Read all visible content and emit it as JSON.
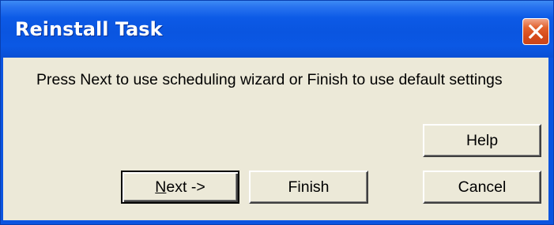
{
  "window": {
    "title": "Reinstall Task"
  },
  "message": {
    "text": "Press Next to use scheduling wizard or Finish to use default settings"
  },
  "buttons": {
    "help": "Help",
    "next_mnemonic": "N",
    "next_rest": "ext ->",
    "finish": "Finish",
    "cancel": "Cancel"
  },
  "icons": {
    "close": "close-icon"
  },
  "colors": {
    "titlebar": "#0a55e0",
    "close_button": "#d54a1a",
    "dialog_background": "#ece9d8"
  }
}
